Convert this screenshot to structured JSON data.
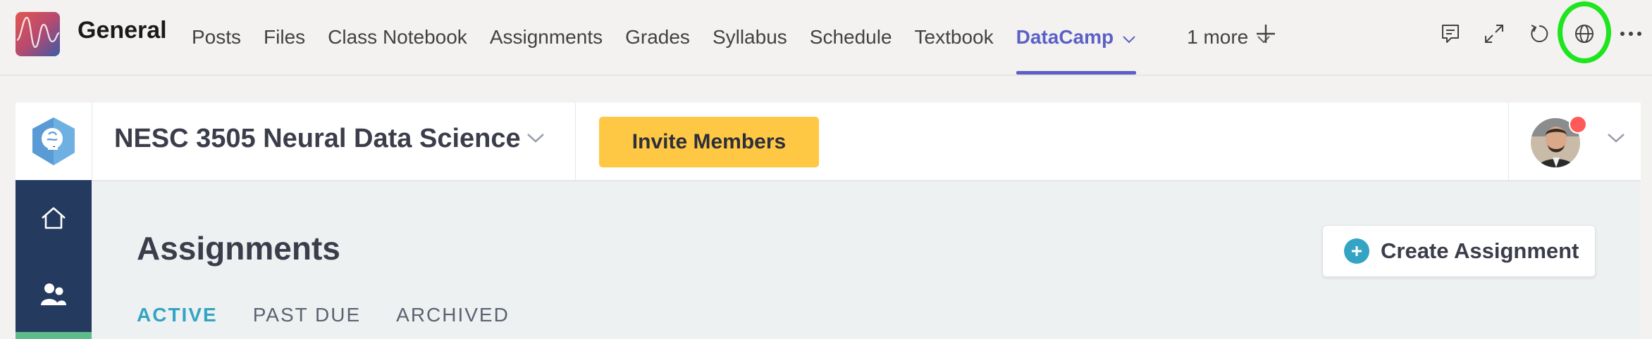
{
  "teams": {
    "channel_name": "General",
    "tabs": [
      {
        "label": "Posts"
      },
      {
        "label": "Files"
      },
      {
        "label": "Class Notebook"
      },
      {
        "label": "Assignments"
      },
      {
        "label": "Grades"
      },
      {
        "label": "Syllabus"
      },
      {
        "label": "Schedule"
      },
      {
        "label": "Textbook"
      },
      {
        "label": "DataCamp",
        "active": true
      },
      {
        "label": "1 more"
      }
    ],
    "right_icons": [
      "conversation-icon",
      "expand-icon",
      "refresh-icon",
      "globe-icon",
      "more-options-icon"
    ],
    "highlight_color": "#1ee51e",
    "accent_color": "#5b5fc7"
  },
  "datacamp": {
    "group_title": "NESC 3505 Neural Data Science",
    "invite_label": "Invite Members",
    "invite_color": "#ffc844",
    "page_title": "Assignments",
    "create_label": "Create Assignment",
    "sub_tabs": {
      "active": "ACTIVE",
      "past_due": "PAST DUE",
      "archived": "ARCHIVED"
    },
    "accent_color": "#33a4c3",
    "sidebar_color": "#243a5e"
  }
}
